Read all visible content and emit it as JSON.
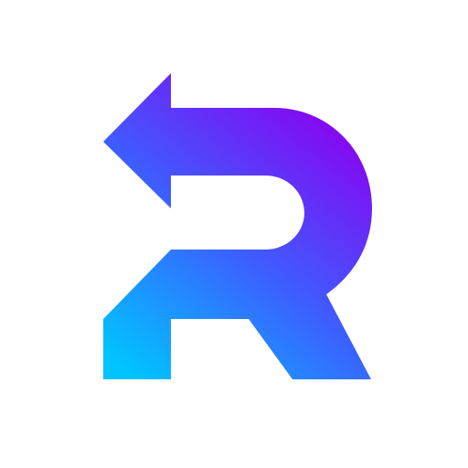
{
  "logo": {
    "icon": "r-return-arrow-icon",
    "gradient_top": "#8B00F0",
    "gradient_mid": "#3F5BFF",
    "gradient_bottom": "#00C4FF",
    "background": "#FFFFFF"
  }
}
